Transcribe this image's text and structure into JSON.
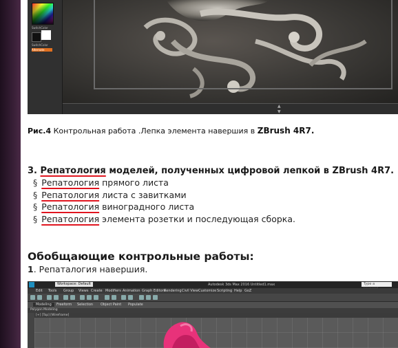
{
  "figure4": {
    "zbrush_ui": {
      "swatch_label": "SwitchColor",
      "switch_label": "SwitchColor",
      "alternate_button": "Alternate"
    },
    "caption_label": "Рис.4",
    "caption_text": "Контрольная работа .Лепка элемента навершия в",
    "caption_program": "ZBrush 4R7."
  },
  "section3": {
    "number": "3.",
    "title_underlined": "Репатология",
    "title_rest": "моделей, полученных цифровой лепкой в ZBrush 4R7.",
    "bullet": "§",
    "items": [
      {
        "underlined": "Репатология",
        "rest": "прямого листа"
      },
      {
        "underlined": "Репатология",
        "rest": " листа с завитками"
      },
      {
        "underlined": "Репатология",
        "rest": " виноградного листа"
      },
      {
        "underlined": "Репатология",
        "rest": "элемента розетки и последующая сборка."
      }
    ]
  },
  "generalized": {
    "heading": "Обобщающие контрольные работы:",
    "item1_number": "1",
    "item1_text": ". Репаталогия навершия."
  },
  "max_ui": {
    "workspace": "Workspace: Default",
    "app_title": "Autodesk 3ds Max 2016     Untitled1.max",
    "search_placeholder": "Type a keyword",
    "menus": [
      "Edit",
      "Tools",
      "Group",
      "Views",
      "Create",
      "Modifiers",
      "Animation",
      "Graph Editors",
      "Rendering",
      "Civil View",
      "Customize",
      "Scripting",
      "Help",
      "GoZ"
    ],
    "ribbon_tabs": [
      "Modeling",
      "Freeform",
      "Selection",
      "Object Paint",
      "Populate"
    ],
    "ribbon_active": "Modeling",
    "sub_label": "Polygon Modeling",
    "viewport_label": "[+] [Top] [Wireframe]",
    "colors": {
      "model_pink": "#e8327a"
    }
  },
  "colors": {
    "underline": "#e0141e",
    "page_bg": "#ffffff",
    "side_bg": "#2a1a2a"
  }
}
